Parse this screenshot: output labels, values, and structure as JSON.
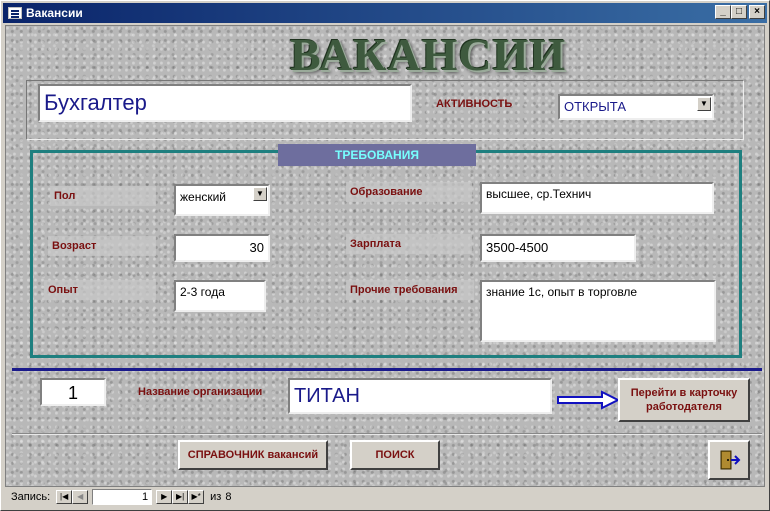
{
  "window": {
    "title": "Вакансии"
  },
  "header": {
    "big_title": "ВАКАНСИИ"
  },
  "vacancy": {
    "name": "Бухгалтер",
    "activity_label": "АКТИВНОСТЬ",
    "activity_value": "ОТКРЫТА"
  },
  "requirements": {
    "title": "ТРЕБОВАНИЯ",
    "gender_label": "Пол",
    "gender_value": "женский",
    "age_label": "Возраст",
    "age_value": "30",
    "experience_label": "Опыт",
    "experience_value": "2-3 года",
    "education_label": "Образование",
    "education_value": "высшее, ср.Технич",
    "salary_label": "Зарплата",
    "salary_value": "3500-4500",
    "other_label": "Прочие требования",
    "other_value": "знание 1с, опыт в торговле"
  },
  "employer": {
    "id_value": "1",
    "org_label": "Название организации",
    "org_value": "ТИТАН",
    "goto_button": "Перейти в карточку работодателя"
  },
  "buttons": {
    "directory": "СПРАВОЧНИК вакансий",
    "search": "ПОИСК"
  },
  "navigation": {
    "record_label": "Запись:",
    "current": "1",
    "of_label": "из",
    "total": "8"
  }
}
